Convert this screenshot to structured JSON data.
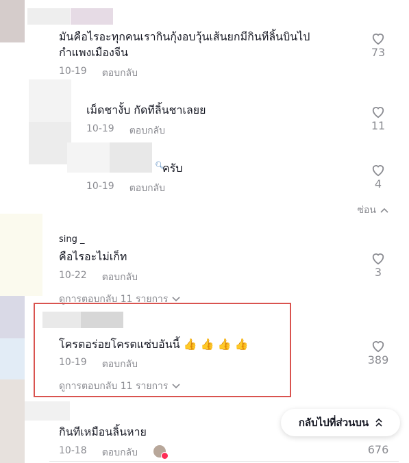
{
  "comments": [
    {
      "text_line1": "มันคือไรอะทุกคนเรากินกุ้งอบวุ้นเส้นยกมีกินทีลิ้นบินไป",
      "text_line2": "กำแพงเมืองจีน",
      "date": "10-19",
      "reply": "ตอบกลับ",
      "likes": "73"
    },
    {
      "text": "เม็ดชางั้บ กัดทีลิ้นชาเลยย",
      "date": "10-19",
      "reply": "ตอบกลับ",
      "likes": "11"
    },
    {
      "text": "ครับ",
      "date": "10-19",
      "reply": "ตอบกลับ",
      "likes": "4"
    },
    {
      "username": "sing _",
      "text": "คือไรอะไม่เก็ท",
      "date": "10-22",
      "reply": "ตอบกลับ",
      "likes": "3",
      "view_replies": "ดูการตอบกลับ 11 รายการ"
    },
    {
      "text": "โครตอร่อยโครตแซ่บอันนี้ 👍 👍 👍 👍",
      "date": "10-19",
      "reply": "ตอบกลับ",
      "likes": "389",
      "view_replies": "ดูการตอบกลับ 11 รายการ"
    },
    {
      "text": "กินทีเหมือนลิ้นหาย",
      "date": "10-18",
      "reply": "ตอบกลับ",
      "likes": "676"
    }
  ],
  "hide_label": "ซ่อน",
  "back_to_top": "กลับไปที่ส่วนบน",
  "colors": {
    "highlight": "#d9534f",
    "muted": "#8a8b91",
    "text": "#161823",
    "like_badge": "#fe2c55"
  }
}
